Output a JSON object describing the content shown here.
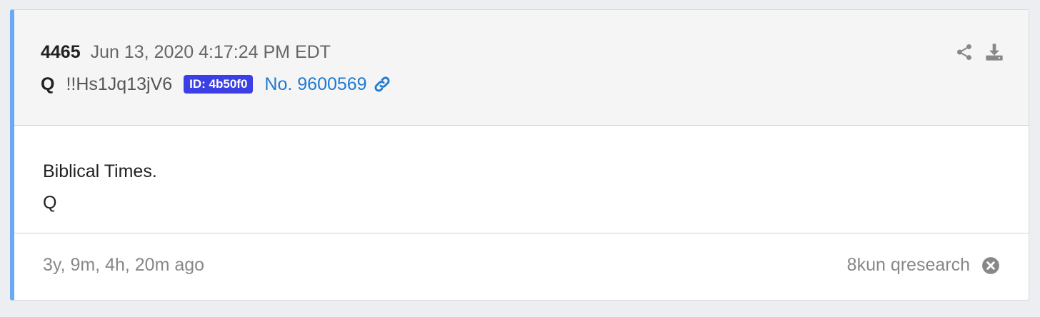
{
  "post": {
    "number": "4465",
    "timestamp": "Jun 13, 2020 4:17:24 PM EDT",
    "author": "Q",
    "tripcode": "!!Hs1Jq13jV6",
    "id_badge": "ID: 4b50f0",
    "link_text": "No. 9600569",
    "body_lines": [
      "Biblical Times.",
      "Q"
    ]
  },
  "footer": {
    "age": "3y, 9m, 4h, 20m ago",
    "source": "8kun qresearch"
  },
  "icons": {
    "share": "share-icon",
    "download": "download-icon",
    "link": "link-icon",
    "close": "close-circle-icon"
  },
  "colors": {
    "accent_border": "#6aaaf4",
    "id_badge_bg": "#3c3fe3",
    "link": "#1f7ad1"
  }
}
